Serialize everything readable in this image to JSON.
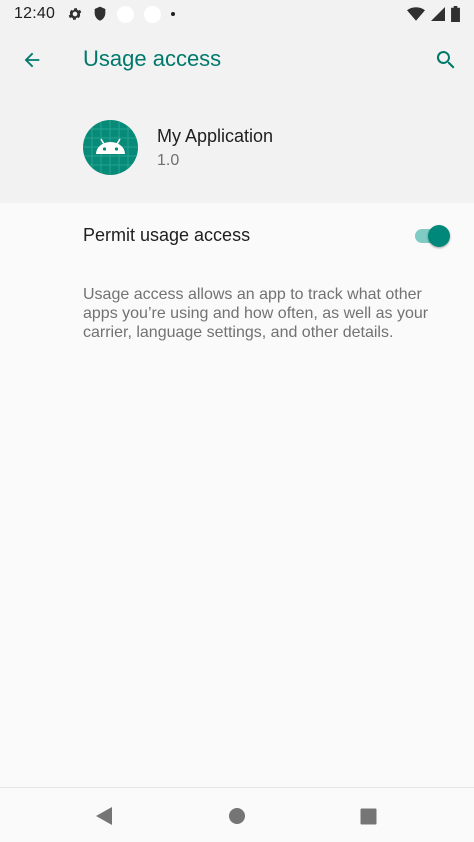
{
  "status_bar": {
    "time": "12:40",
    "icons_left": [
      "settings-gear-icon",
      "shield-icon",
      "notification-circle-icon",
      "notification-circle-icon",
      "more-dot-icon"
    ],
    "icons_right": [
      "wifi-icon",
      "cell-signal-icon",
      "battery-icon"
    ]
  },
  "toolbar": {
    "title": "Usage access",
    "back_icon": "arrow-left-icon",
    "search_icon": "search-icon",
    "accent_color": "#00796b"
  },
  "app": {
    "name": "My Application",
    "version": "1.0",
    "icon": "android-robot-icon",
    "icon_color": "#078a78"
  },
  "permit": {
    "label": "Permit usage access",
    "enabled": true,
    "switch_color": "#00897b"
  },
  "description": "Usage access allows an app to track what other apps you’re using and how often, as well as your carrier, language settings, and other details.",
  "nav_bar": {
    "buttons": [
      "back-triangle-icon",
      "home-circle-icon",
      "recents-square-icon"
    ]
  }
}
